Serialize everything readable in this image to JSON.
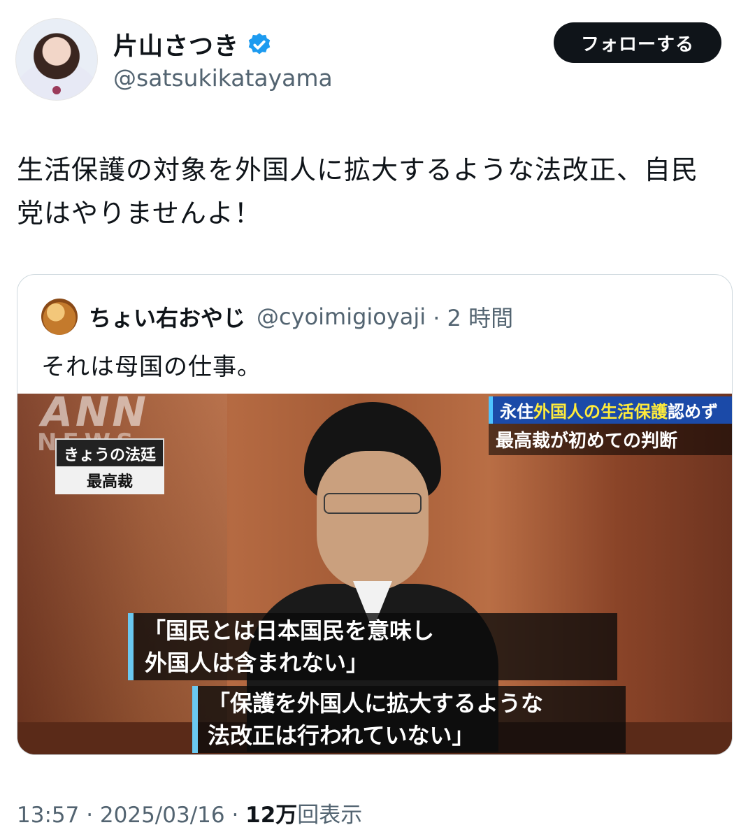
{
  "author": {
    "name": "片山さつき",
    "handle": "@satsukikatayama",
    "verified": true
  },
  "follow_button": {
    "label": "フォローする"
  },
  "tweet": {
    "text": "生活保護の対象を外国人に拡大するような法改正、自民党はやりませんよ！"
  },
  "quoted_tweet": {
    "name": "ちょい右おやじ",
    "handle": "@cyoimigioyaji",
    "time": "· 2 時間",
    "text": "それは母国の仕事。",
    "media": {
      "logo_ann": "ANN",
      "logo_news": "NEWS",
      "tag_program": "きょうの法廷",
      "tag_court": "最高裁",
      "headline_part1": "永住",
      "headline_highlight": "外国人の生活保護",
      "headline_part2": "認めず",
      "headline_line2": "最高裁が初めての判断",
      "caption_1_line1": "「国民とは日本国民を意味し",
      "caption_1_line2": "外国人は含まれない」",
      "caption_2_line1": "「保護を外国人に拡大するような",
      "caption_2_line2": "法改正は行われていない」"
    }
  },
  "meta": {
    "time": "13:57",
    "date": "· 2025/03/16 ·",
    "views_count": "12万",
    "views_label": "回表示"
  },
  "colors": {
    "verified_blue": "#1d9bf0",
    "follow_bg": "#0f1419",
    "muted_text": "#536471"
  }
}
